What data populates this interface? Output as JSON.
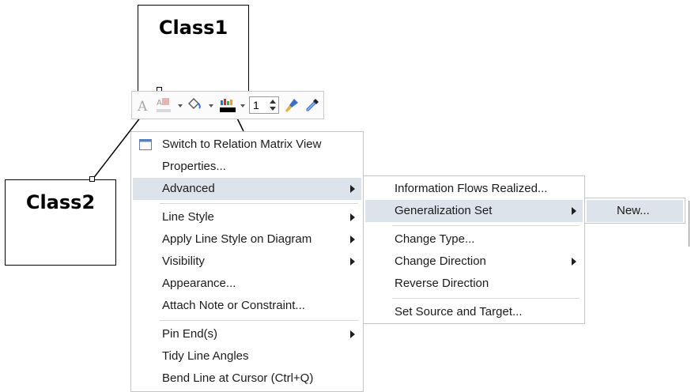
{
  "diagram": {
    "class1": {
      "name": "Class1"
    },
    "class2": {
      "name": "Class2"
    }
  },
  "toolbar": {
    "line_width": "1",
    "icons": [
      "font-icon",
      "text-color-icon",
      "fill-color-icon",
      "line-color-icon",
      "line-width-stepper",
      "format-painter-icon",
      "color-picker-icon"
    ],
    "colors": {
      "fill": "#2a6fdb",
      "line_red": "#d92b2b",
      "line_black": "#000000"
    }
  },
  "context_menu": {
    "items": [
      {
        "label": "Switch to Relation Matrix View",
        "icon": "matrix-view-icon"
      },
      {
        "label": "Properties..."
      },
      {
        "label": "Advanced",
        "submenu": true,
        "highlighted": true
      },
      {
        "label": "Line Style",
        "submenu": true
      },
      {
        "label": "Apply Line Style on Diagram",
        "submenu": true
      },
      {
        "label": "Visibility",
        "submenu": true
      },
      {
        "label": "Appearance..."
      },
      {
        "label": "Attach Note or Constraint..."
      },
      {
        "label": "Pin End(s)",
        "submenu": true
      },
      {
        "label": "Tidy Line Angles"
      },
      {
        "label": "Bend Line at Cursor (Ctrl+Q)"
      }
    ]
  },
  "advanced_menu": {
    "items": [
      {
        "label": "Information Flows Realized..."
      },
      {
        "label": "Generalization Set",
        "submenu": true,
        "highlighted": true
      },
      {
        "label": "Change Type..."
      },
      {
        "label": "Change Direction",
        "submenu": true
      },
      {
        "label": "Reverse Direction"
      },
      {
        "label": "Set Source and Target..."
      }
    ]
  },
  "generalization_menu": {
    "items": [
      {
        "label": "New...",
        "highlighted": true
      }
    ]
  },
  "colors": {
    "menu_highlight": "#dde3ea",
    "menu_border": "#c5c5c5"
  }
}
